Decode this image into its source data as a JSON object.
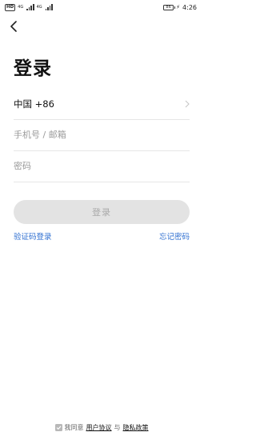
{
  "status_bar": {
    "badge": "HD",
    "signal1_label": "4G",
    "signal2_label": "4G",
    "battery": "86",
    "time": "4:26"
  },
  "icons": {
    "back": "chevron-left-icon",
    "country_arrow": "chevron-right-icon",
    "checkbox": "checkmark-icon"
  },
  "title": "登录",
  "form": {
    "country": "中国 +86",
    "phone_placeholder": "手机号 / 邮箱",
    "password_placeholder": "密码",
    "login_label": "登录"
  },
  "links": {
    "code_login": "验证码登录",
    "forgot": "忘记密码"
  },
  "agreement": {
    "prefix": "我同意",
    "user_agreement": "用户协议",
    "conjunction": "与",
    "privacy_policy": "隐私政策",
    "checked": true
  },
  "colors": {
    "link": "#2f6fd1",
    "button_bg": "#e3e3e3",
    "button_text": "#a9a9a9"
  }
}
